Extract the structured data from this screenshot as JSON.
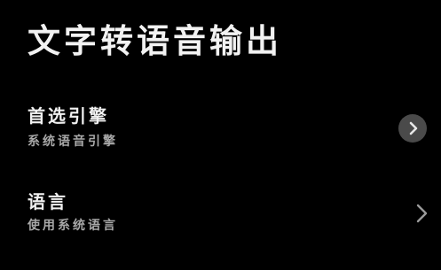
{
  "header": {
    "title": "文字转语音输出"
  },
  "settings": {
    "engine": {
      "title": "首选引擎",
      "value": "系统语音引擎",
      "chevron_icon": "chevron-right-circle-icon"
    },
    "language": {
      "title": "语言",
      "value": "使用系统语言",
      "chevron_icon": "chevron-right-icon"
    }
  },
  "colors": {
    "background": "#000000",
    "title_text": "#f2f2f2",
    "secondary_text": "#a8a8a8",
    "chevron_circle_bg": "#4a4a4a"
  }
}
